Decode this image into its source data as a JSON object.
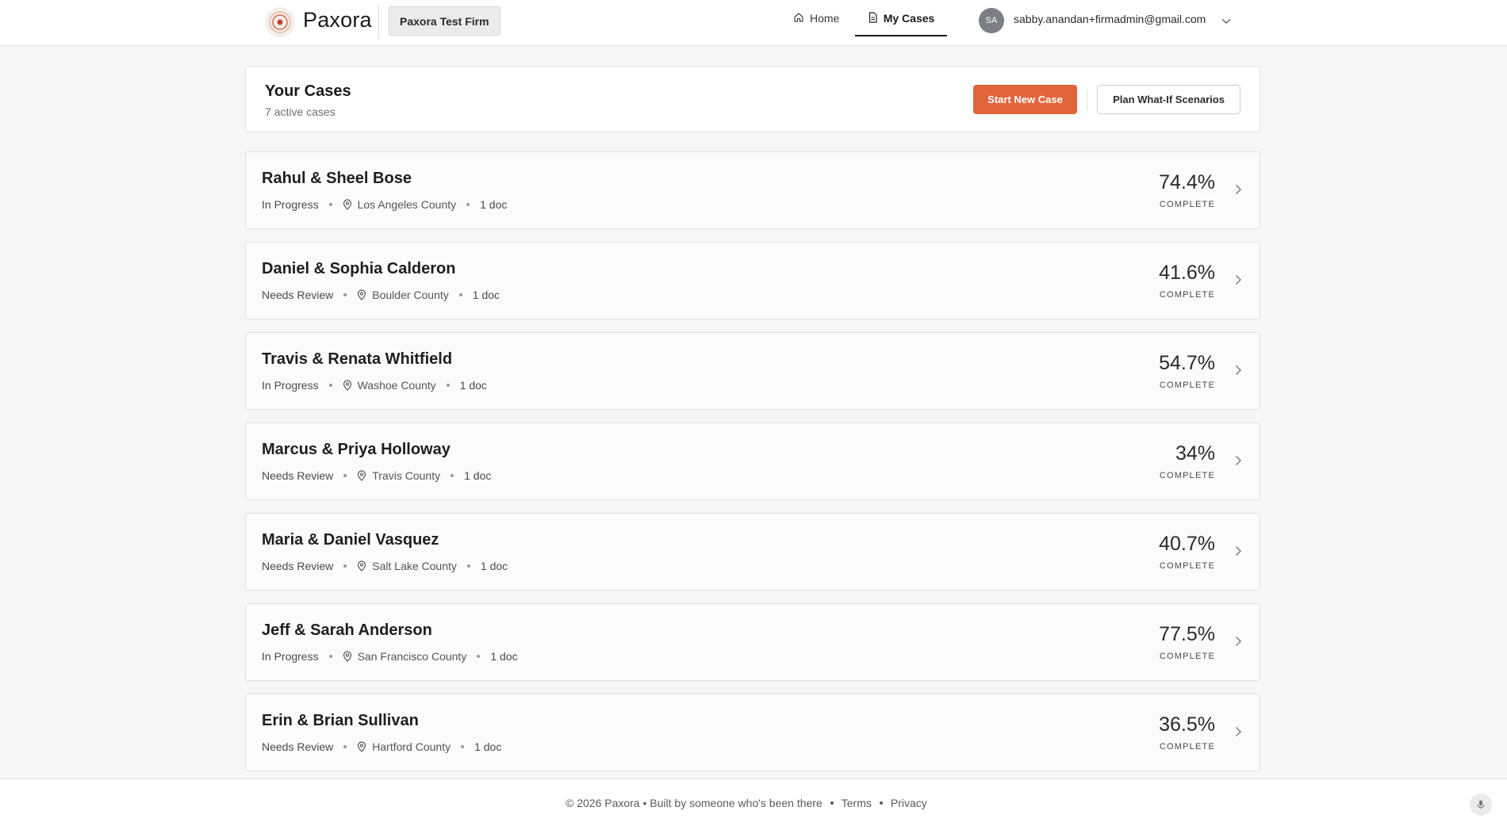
{
  "app": {
    "name": "Paxora",
    "firm": "Paxora Test Firm"
  },
  "nav": {
    "home": "Home",
    "my_cases": "My Cases",
    "home_icon": "home-icon",
    "cases_icon": "document-icon"
  },
  "user": {
    "initials": "SA",
    "email": "sabby.anandan+firmadmin@gmail.com"
  },
  "header": {
    "title": "Your Cases",
    "subtitle": "7 active cases",
    "start_button": "Start New Case",
    "plan_button": "Plan What-If Scenarios"
  },
  "cases": [
    {
      "name": "Rahul & Sheel Bose",
      "status": "In Progress",
      "county": "Los Angeles County",
      "docs": "1 doc",
      "percent": "74.4%",
      "complete_label": "COMPLETE"
    },
    {
      "name": "Daniel & Sophia Calderon",
      "status": "Needs Review",
      "county": "Boulder County",
      "docs": "1 doc",
      "percent": "41.6%",
      "complete_label": "COMPLETE"
    },
    {
      "name": "Travis & Renata Whitfield",
      "status": "In Progress",
      "county": "Washoe County",
      "docs": "1 doc",
      "percent": "54.7%",
      "complete_label": "COMPLETE"
    },
    {
      "name": "Marcus & Priya Holloway",
      "status": "Needs Review",
      "county": "Travis County",
      "docs": "1 doc",
      "percent": "34%",
      "complete_label": "COMPLETE"
    },
    {
      "name": "Maria & Daniel Vasquez",
      "status": "Needs Review",
      "county": "Salt Lake County",
      "docs": "1 doc",
      "percent": "40.7%",
      "complete_label": "COMPLETE"
    },
    {
      "name": "Jeff & Sarah Anderson",
      "status": "In Progress",
      "county": "San Francisco County",
      "docs": "1 doc",
      "percent": "77.5%",
      "complete_label": "COMPLETE"
    },
    {
      "name": "Erin & Brian Sullivan",
      "status": "Needs Review",
      "county": "Hartford County",
      "docs": "1 doc",
      "percent": "36.5%",
      "complete_label": "COMPLETE"
    }
  ],
  "footer": {
    "copyright": "© 2026 Paxora • Built by someone who's been there",
    "terms": "Terms",
    "privacy": "Privacy"
  },
  "colors": {
    "accent": "#e0653a",
    "background": "#f7f6f4"
  }
}
